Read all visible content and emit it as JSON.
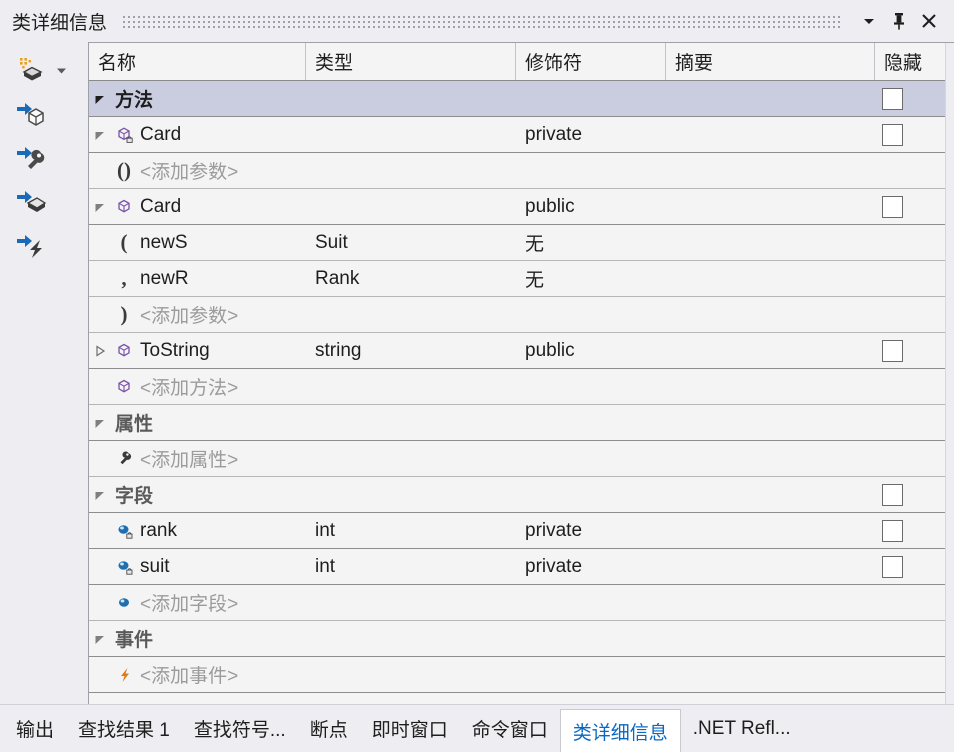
{
  "titlebar": {
    "title": "类详细信息",
    "dropdown_icon": "chevron-down-icon",
    "pin_icon": "pin-icon",
    "close_icon": "close-icon"
  },
  "toolbar": {
    "items": [
      {
        "icon": "new-class-icon",
        "has_caret": true
      },
      {
        "icon": "add-method-icon",
        "has_caret": false
      },
      {
        "icon": "add-property-icon",
        "has_caret": false
      },
      {
        "icon": "add-field-icon",
        "has_caret": false
      },
      {
        "icon": "add-event-icon",
        "has_caret": false
      }
    ]
  },
  "grid": {
    "headers": [
      {
        "label": "名称"
      },
      {
        "label": "类型"
      },
      {
        "label": "修饰符"
      },
      {
        "label": "摘要"
      },
      {
        "label": "隐藏"
      }
    ],
    "rows": [
      {
        "kind": "group",
        "indent": 0,
        "expander": "expanded-dark",
        "icon": "none",
        "name": "方法",
        "type": "",
        "modifier": "",
        "summary": "",
        "checkbox": true,
        "selected": true
      },
      {
        "kind": "member",
        "indent": 1,
        "expander": "expanded-gray",
        "icon": "method-private-icon",
        "name": "Card",
        "type": "",
        "modifier": "private",
        "summary": "",
        "checkbox": true,
        "selected": false
      },
      {
        "kind": "param-add",
        "indent": 2,
        "expander": "none",
        "icon": "paren-open-close",
        "name": "<添加参数>",
        "type": "",
        "modifier": "",
        "summary": "",
        "checkbox": false,
        "selected": false
      },
      {
        "kind": "member",
        "indent": 1,
        "expander": "expanded-gray",
        "icon": "method-public-icon",
        "name": "Card",
        "type": "",
        "modifier": "public",
        "summary": "",
        "checkbox": true,
        "selected": false
      },
      {
        "kind": "param",
        "indent": 2,
        "expander": "none",
        "icon": "paren-open",
        "name": "newS",
        "type": "Suit",
        "modifier": "无",
        "summary": "",
        "checkbox": false,
        "selected": false
      },
      {
        "kind": "param",
        "indent": 2,
        "expander": "none",
        "icon": "comma",
        "name": "newR",
        "type": "Rank",
        "modifier": "无",
        "summary": "",
        "checkbox": false,
        "selected": false
      },
      {
        "kind": "param-add",
        "indent": 2,
        "expander": "none",
        "icon": "paren-close",
        "name": "<添加参数>",
        "type": "",
        "modifier": "",
        "summary": "",
        "checkbox": false,
        "selected": false
      },
      {
        "kind": "member",
        "indent": 1,
        "expander": "collapsed-gray",
        "icon": "method-public-icon",
        "name": "ToString",
        "type": "string",
        "modifier": "public",
        "summary": "",
        "checkbox": true,
        "selected": false
      },
      {
        "kind": "add",
        "indent": 1,
        "expander": "none",
        "icon": "method-public-icon",
        "name": "<添加方法>",
        "type": "",
        "modifier": "",
        "summary": "",
        "checkbox": false,
        "selected": false
      },
      {
        "kind": "group",
        "indent": 0,
        "expander": "expanded-gray",
        "icon": "none",
        "name": "属性",
        "type": "",
        "modifier": "",
        "summary": "",
        "checkbox": false,
        "selected": false
      },
      {
        "kind": "add",
        "indent": 1,
        "expander": "none",
        "icon": "property-icon",
        "name": "<添加属性>",
        "type": "",
        "modifier": "",
        "summary": "",
        "checkbox": false,
        "selected": false
      },
      {
        "kind": "group",
        "indent": 0,
        "expander": "expanded-gray",
        "icon": "none",
        "name": "字段",
        "type": "",
        "modifier": "",
        "summary": "",
        "checkbox": true,
        "selected": false
      },
      {
        "kind": "member",
        "indent": 2,
        "expander": "none",
        "icon": "field-private-icon",
        "name": "rank",
        "type": "int",
        "modifier": "private",
        "summary": "",
        "checkbox": true,
        "selected": false
      },
      {
        "kind": "member",
        "indent": 2,
        "expander": "none",
        "icon": "field-private-icon",
        "name": "suit",
        "type": "int",
        "modifier": "private",
        "summary": "",
        "checkbox": true,
        "selected": false
      },
      {
        "kind": "add",
        "indent": 2,
        "expander": "none",
        "icon": "field-icon",
        "name": "<添加字段>",
        "type": "",
        "modifier": "",
        "summary": "",
        "checkbox": false,
        "selected": false
      },
      {
        "kind": "group",
        "indent": 0,
        "expander": "expanded-gray",
        "icon": "none",
        "name": "事件",
        "type": "",
        "modifier": "",
        "summary": "",
        "checkbox": false,
        "selected": false
      },
      {
        "kind": "add",
        "indent": 2,
        "expander": "none",
        "icon": "event-icon",
        "name": "<添加事件>",
        "type": "",
        "modifier": "",
        "summary": "",
        "checkbox": false,
        "selected": false
      }
    ]
  },
  "tabs": [
    {
      "label": "输出",
      "active": false
    },
    {
      "label": "查找结果 1",
      "active": false
    },
    {
      "label": "查找符号...",
      "active": false
    },
    {
      "label": "断点",
      "active": false
    },
    {
      "label": "即时窗口",
      "active": false
    },
    {
      "label": "命令窗口",
      "active": false
    },
    {
      "label": "类详细信息",
      "active": true
    },
    {
      "label": ".NET Refl...",
      "active": false
    }
  ],
  "colors": {
    "panel_bg": "#eeeef2",
    "row_bg": "#f4f4f4",
    "selected_row": "#c9cddf",
    "active_tab_text": "#0968c3",
    "method_icon": "#7a52a8",
    "field_icon": "#1f6fb0",
    "event_icon": "#e07a16",
    "placeholder_text": "#9b9b9b"
  }
}
